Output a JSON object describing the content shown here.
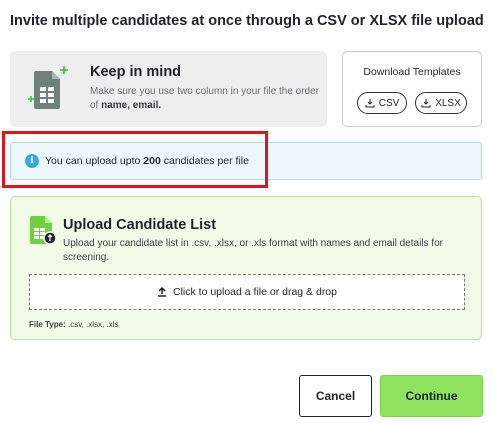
{
  "dialog": {
    "title": "Invite multiple candidates at once through a CSV or XLSX file upload"
  },
  "keep_in_mind": {
    "heading": "Keep in mind",
    "text_prefix": "Make sure you use two column in your file the order of ",
    "text_bold": "name, email.",
    "icon": "spreadsheet-file-icon"
  },
  "templates": {
    "title": "Download Templates",
    "csv_label": "CSV",
    "xlsx_label": "XLSX",
    "icon": "download-icon"
  },
  "notice": {
    "prefix": "You can upload upto ",
    "count": "200",
    "suffix": " candidates per file",
    "icon": "info-icon"
  },
  "upload": {
    "heading": "Upload Candidate List",
    "description": "Upload your candidate list in .csv, .xlsx, or .xls format with names and email details for screening.",
    "dropzone_label": "Click to upload a file or drag & drop",
    "filetype_label": "File Type:",
    "filetype_values": " .csv, .xlsx, .xls",
    "icon": "upload-file-icon"
  },
  "actions": {
    "cancel_label": "Cancel",
    "continue_label": "Continue"
  },
  "colors": {
    "accent_green": "#8fe35f",
    "highlight_red": "#e0141e",
    "info_blue": "#38a9df"
  }
}
